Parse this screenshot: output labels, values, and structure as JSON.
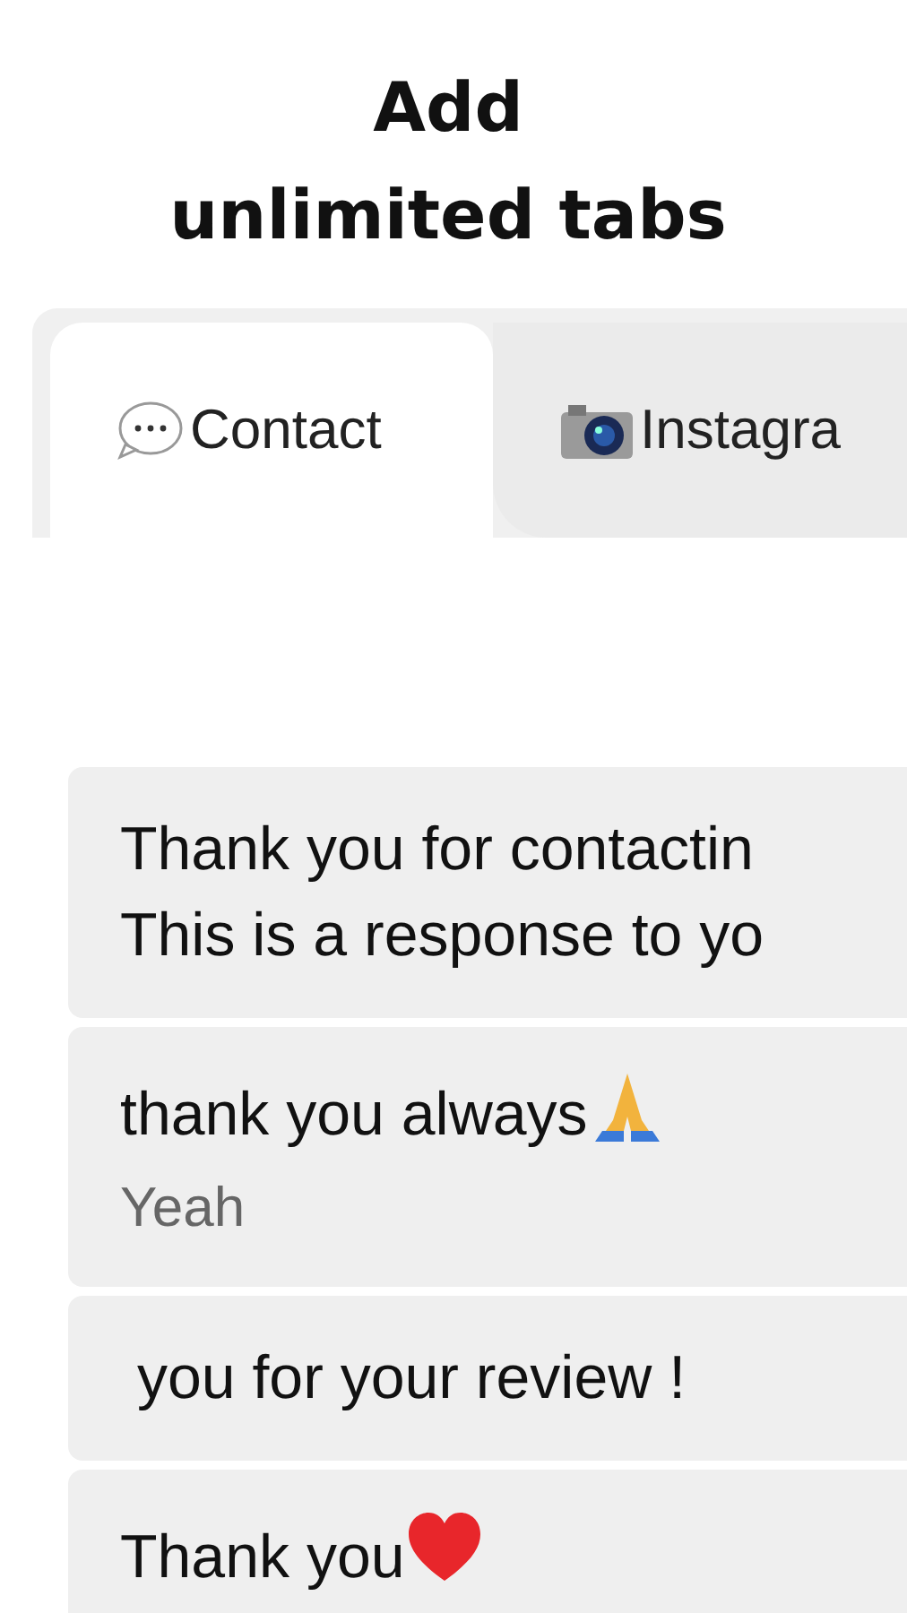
{
  "headline": [
    "Add",
    "unlimited tabs"
  ],
  "tabs": [
    {
      "label": "Contact",
      "selected": true
    },
    {
      "label": "Instagra",
      "selected": false
    }
  ],
  "messages": [
    {
      "lines": [
        "Thank you for contactin",
        "This is a response to yo"
      ]
    },
    {
      "lines": [
        "thank you always"
      ],
      "note": "Yeah"
    },
    {
      "lines": [
        " you for your review !"
      ]
    },
    {
      "lines": [
        "Thank you"
      ]
    }
  ]
}
